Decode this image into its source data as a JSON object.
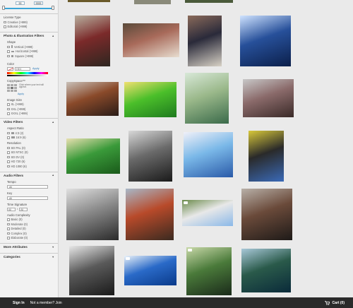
{
  "sidebar": {
    "price": {
      "min": "$$",
      "max": "$$$$"
    },
    "license": {
      "title": "License Type",
      "options": [
        {
          "label": "Creative",
          "count": "(>999)"
        },
        {
          "label": "Editorial",
          "count": "(>999)"
        }
      ]
    },
    "photo_filters": {
      "title": "Photo & Illustration Filters",
      "shape_title": "Shape",
      "shapes": [
        {
          "label": "Vertical",
          "count": "(>999)"
        },
        {
          "label": "Horizontal",
          "count": "(>999)"
        },
        {
          "label": "Square",
          "count": "(>999)"
        }
      ],
      "color_title": "Color",
      "hex_placeholder": "HEX",
      "apply_label": "Apply",
      "copyspace_title": "CopySpace™",
      "copyspace_hint": "Click where your text will appear.",
      "copyspace_apply": "Apply",
      "size_title": "Image Size",
      "sizes": [
        {
          "label": "XL",
          "count": "(>999)"
        },
        {
          "label": "XXL",
          "count": "(>999)"
        },
        {
          "label": "XXXL",
          "count": "(>999)"
        }
      ]
    },
    "video_filters": {
      "title": "Video Filters",
      "aspect_title": "Aspect Ratio",
      "aspects": [
        {
          "label": "4:3",
          "count": "(2)"
        },
        {
          "label": "16:9",
          "count": "(6)"
        }
      ],
      "resolution_title": "Resolution",
      "resolutions": [
        {
          "label": "SD PAL",
          "count": "(0)"
        },
        {
          "label": "SD NTSC",
          "count": "(0)"
        },
        {
          "label": "SD DV",
          "count": "(0)"
        },
        {
          "label": "HD 720",
          "count": "(6)"
        },
        {
          "label": "HD 1080",
          "count": "(6)"
        }
      ]
    },
    "audio_filters": {
      "title": "Audio Filters",
      "tempo_title": "Tempo",
      "tempo_value": "All",
      "key_title": "Key",
      "key_value": "All",
      "time_sig_title": "Time Signature",
      "time_sig_values": [
        "All",
        "/",
        "All"
      ],
      "complexity_title": "Audio Complexity",
      "complexity": [
        {
          "label": "Basic",
          "count": "(0)"
        },
        {
          "label": "Moderate",
          "count": "(0)"
        },
        {
          "label": "Detailed",
          "count": "(0)"
        },
        {
          "label": "Complex",
          "count": "(0)"
        },
        {
          "label": "Elaborate",
          "count": "(0)"
        }
      ]
    },
    "more_attributes": "More Attributes",
    "categories": "Categories"
  },
  "footer": {
    "sign_in": "Sign In",
    "not_member": "Not a member? Join",
    "cart": "Cart (0)"
  },
  "grid": {
    "tiles": [
      {
        "name": "thumb-bagpiper-boy",
        "colors": [
          "#2d2620",
          "#7b2a2a",
          "#b8b0a0"
        ],
        "video": false
      },
      {
        "name": "thumb-highland-dancers",
        "colors": [
          "#e7ddd0",
          "#a86a5a",
          "#5a4a3a"
        ],
        "video": false
      },
      {
        "name": "thumb-highland-dancer-girl",
        "colors": [
          "#d8d2c6",
          "#2a2a3a",
          "#8a6a5a"
        ],
        "video": false
      },
      {
        "name": "thumb-moon-over-water",
        "colors": [
          "#0b1f4a",
          "#27509a",
          "#cfe3ff"
        ],
        "video": false
      },
      {
        "name": "thumb-burned-building",
        "colors": [
          "#2a1c18",
          "#8a4a2a",
          "#c8c0b8"
        ],
        "video": false
      },
      {
        "name": "thumb-swallowtail-butterfly",
        "colors": [
          "#1e7a1e",
          "#4bbf2a",
          "#f0e070"
        ],
        "video": false
      },
      {
        "name": "thumb-tall-grass",
        "colors": [
          "#3a6a4a",
          "#9ab88a",
          "#d8e8d8"
        ],
        "video": false
      },
      {
        "name": "thumb-burned-stairs",
        "colors": [
          "#3a2a28",
          "#8a6a6a",
          "#c8c8c8"
        ],
        "video": false
      },
      {
        "name": "thumb-butterfly-leaves",
        "colors": [
          "#1a5a1a",
          "#3a9a3a",
          "#e8e0b0"
        ],
        "video": false
      },
      {
        "name": "thumb-ruins-black-white",
        "colors": [
          "#1a1a1a",
          "#6a6a6a",
          "#d8d8d8"
        ],
        "video": false
      },
      {
        "name": "thumb-blue-ribbon-cake",
        "colors": [
          "#2a5aa8",
          "#7ab8e8",
          "#f0f0f8"
        ],
        "video": false
      },
      {
        "name": "thumb-industrial-ruins",
        "colors": [
          "#3a6ab8",
          "#2a2a2a",
          "#d8c83a"
        ],
        "video": false
      },
      {
        "name": "thumb-burned-frame-bw",
        "colors": [
          "#2a2a2a",
          "#8a8a8a",
          "#e0e0e0"
        ],
        "video": false
      },
      {
        "name": "thumb-chimney-ruins",
        "colors": [
          "#3a2a20",
          "#b84a2a",
          "#a8b8c8"
        ],
        "video": false
      },
      {
        "name": "thumb-lone-tree",
        "colors": [
          "#8ab8e8",
          "#e8e8e8",
          "#6a8a4a"
        ],
        "video": true
      },
      {
        "name": "thumb-burned-debris",
        "colors": [
          "#1e1a18",
          "#6a4a3a",
          "#b8b0a8"
        ],
        "video": false
      },
      {
        "name": "thumb-dead-tree-bw",
        "colors": [
          "#1a1a1a",
          "#5a5a5a",
          "#e8e8e8"
        ],
        "video": false
      },
      {
        "name": "thumb-speedboat",
        "colors": [
          "#0a3a8a",
          "#2a6ac8",
          "#e8f0f8"
        ],
        "video": true
      },
      {
        "name": "thumb-forest-light",
        "colors": [
          "#1a2a1a",
          "#4a7a3a",
          "#c8d8a8"
        ],
        "video": true
      },
      {
        "name": "thumb-forest-reflection",
        "colors": [
          "#0a2a3a",
          "#2a5a4a",
          "#a8c8d8"
        ],
        "video": false
      }
    ]
  }
}
